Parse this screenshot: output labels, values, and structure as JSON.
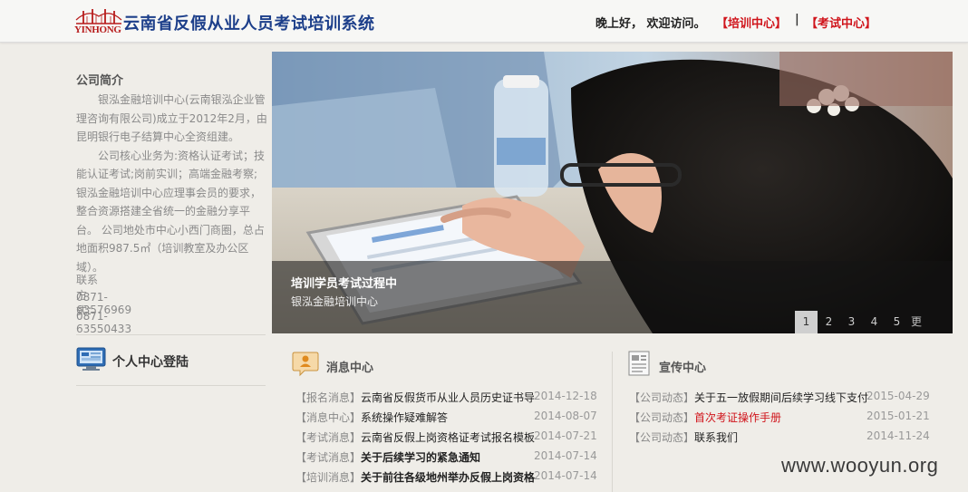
{
  "header": {
    "logo_text": "YINHONG",
    "title": "云南省反假从业人员考试培训系统",
    "greeting": "晚上好， 欢迎访问。",
    "nav_training": "【培训中心】",
    "nav_separator": "|",
    "nav_exam": "【考试中心】"
  },
  "sidebar": {
    "intro_title": "公司简介",
    "intro_p1": "银泓金融培训中心(云南银泓企业管理咨询有限公司)成立于2012年2月，由昆明银行电子结算中心全资组建。",
    "intro_p2": "公司核心业务为:资格认证考试；技能认证考试;岗前实训；高端金融考察;银泓金融培训中心应理事会员的要求，整合资源搭建全省统一的金融分享平台。 公司地处市中心小西门商圈，总占地面积987.5㎡（培训教室及办公区域）。",
    "contact_label": "联系方式：",
    "phone1": "0871-63576969",
    "phone2": "0871-63550433",
    "login_title": "个人中心登陆"
  },
  "banner": {
    "caption_title": "培训学员考试过程中",
    "caption_sub": "银泓金融培训中心",
    "pages": [
      "1",
      "2",
      "3",
      "4",
      "5"
    ],
    "more": "更多>>"
  },
  "news": {
    "title": "消息中心",
    "items": [
      {
        "tag": "【报名消息】",
        "title": "云南省反假货币从业人员历史证书导",
        "date": "2014-12-18",
        "style": ""
      },
      {
        "tag": "【消息中心】",
        "title": "系统操作疑难解答",
        "date": "2014-08-07",
        "style": ""
      },
      {
        "tag": "【考试消息】",
        "title": "云南省反假上岗资格证考试报名模板",
        "date": "2014-07-21",
        "style": ""
      },
      {
        "tag": "【考试消息】",
        "title": "关于后续学习的紧急通知",
        "date": "2014-07-14",
        "style": "bold"
      },
      {
        "tag": "【培训消息】",
        "title": "关于前往各级地州举办反假上岗资格",
        "date": "2014-07-14",
        "style": "bold"
      }
    ]
  },
  "promo": {
    "title": "宣传中心",
    "items": [
      {
        "tag": "【公司动态】",
        "title": "关于五一放假期间后续学习线下支付",
        "date": "2015-04-29",
        "style": ""
      },
      {
        "tag": "【公司动态】",
        "title": "首次考证操作手册",
        "date": "2015-01-21",
        "style": "red"
      },
      {
        "tag": "【公司动态】",
        "title": "联系我们",
        "date": "2014-11-24",
        "style": ""
      }
    ]
  },
  "watermark": "www.wooyun.org",
  "colors": {
    "brand_blue": "#1d3f8a",
    "accent_red": "#d0141b",
    "background": "#efede8"
  }
}
